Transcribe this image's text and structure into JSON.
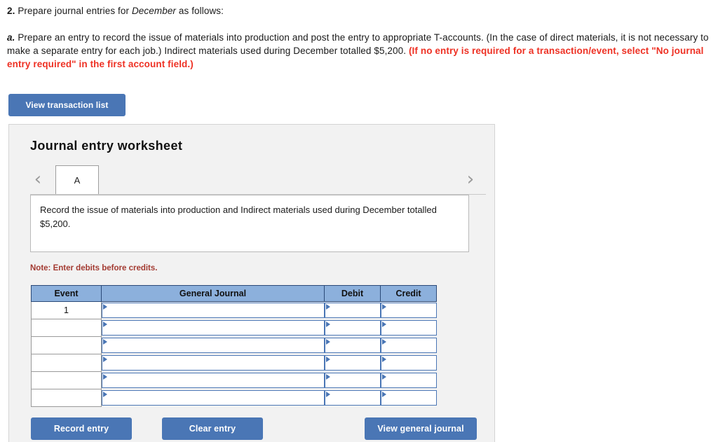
{
  "prompt": {
    "question_number": "2.",
    "question_text_before_italic": " Prepare journal entries for ",
    "question_italic": "December",
    "question_text_after_italic": " as follows:",
    "part_label": "a.",
    "part_text": " Prepare an entry to record the issue of materials into production and post the entry to appropriate T-accounts. (In the case of direct materials, it is not necessary to make a separate entry for each job.) Indirect materials used during December totalled $5,200. ",
    "part_red_text": "(If no entry is required for a transaction/event, select \"No journal entry required\" in the first account field.)"
  },
  "toolbar": {
    "view_transaction_list_label": "View transaction list"
  },
  "worksheet": {
    "title": "Journal entry worksheet",
    "prev_arrow": "‹",
    "next_arrow": "›",
    "tabs": [
      {
        "label": "A",
        "active": true
      }
    ],
    "description": "Record the issue of materials into production and Indirect materials used during December totalled $5,200.",
    "note": "Note: Enter debits before credits.",
    "table": {
      "columns": [
        "Event",
        "General Journal",
        "Debit",
        "Credit"
      ],
      "rows": [
        {
          "event": "1",
          "general_journal": "",
          "debit": "",
          "credit": ""
        },
        {
          "event": "",
          "general_journal": "",
          "debit": "",
          "credit": ""
        },
        {
          "event": "",
          "general_journal": "",
          "debit": "",
          "credit": ""
        },
        {
          "event": "",
          "general_journal": "",
          "debit": "",
          "credit": ""
        },
        {
          "event": "",
          "general_journal": "",
          "debit": "",
          "credit": ""
        },
        {
          "event": "",
          "general_journal": "",
          "debit": "",
          "credit": ""
        }
      ]
    },
    "actions": {
      "record_entry_label": "Record entry",
      "clear_entry_label": "Clear entry",
      "view_general_journal_label": "View general journal"
    }
  },
  "colors": {
    "button_blue": "#4a76b5",
    "table_header_blue": "#8cb0dc",
    "table_header_border": "#2b4a78",
    "note_red": "#a33b32",
    "alert_red": "#ee3124",
    "panel_gray": "#f2f2f2"
  }
}
